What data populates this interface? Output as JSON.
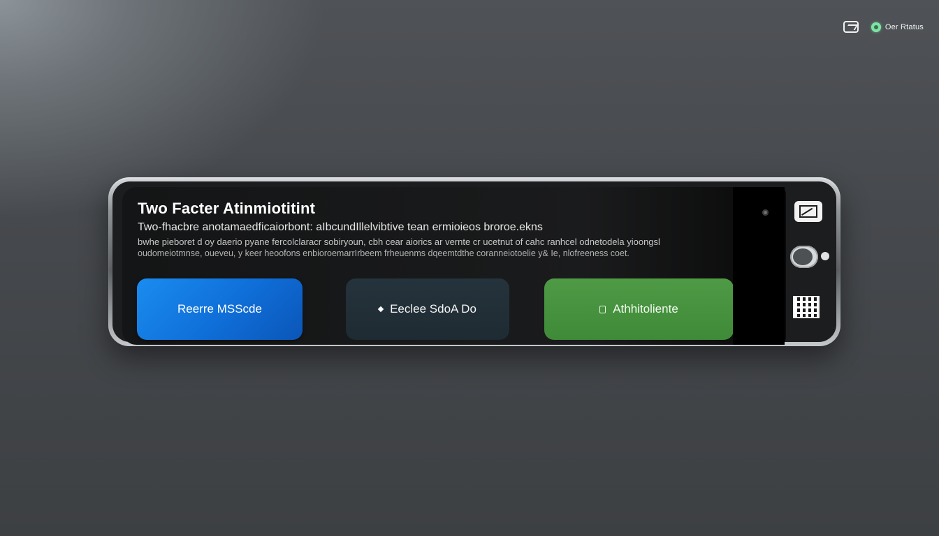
{
  "status_bar": {
    "cast_icon": "cast-icon",
    "status_dot_color": "#7de2a4",
    "status_text": "Oer Rtatus"
  },
  "card": {
    "title": "Two Facter Atinmiotitint",
    "description_line1": "Two-fhacbre anotamaedficaiorbont: aIbcundIllelvibtive tean ermioieos broroe.ekns",
    "description_line2": "bwhe pieboret d oy daerio pyane fercolclaracr sobiryoun, cbh cear aiorics ar vernte cr ucetnut of cahc ranhcel odnetodela yioongsl",
    "description_line3": "oudomeiotmnse, oueveu, y keer heoofons enbioroemarrIrbeem frheuenms dqeemtdthe coranneiotoelie y& Ie, nlofreeness coet."
  },
  "buttons": {
    "primary_label": "Reerre MSScde",
    "secondary_label": "Eeclee SdoA  Do",
    "success_label": "Athhitoliente"
  },
  "side_controls": {
    "cast_icon": "screen-cast-icon",
    "toggle_icon": "toggle-switch",
    "qr_icon": "qr-code-icon"
  }
}
